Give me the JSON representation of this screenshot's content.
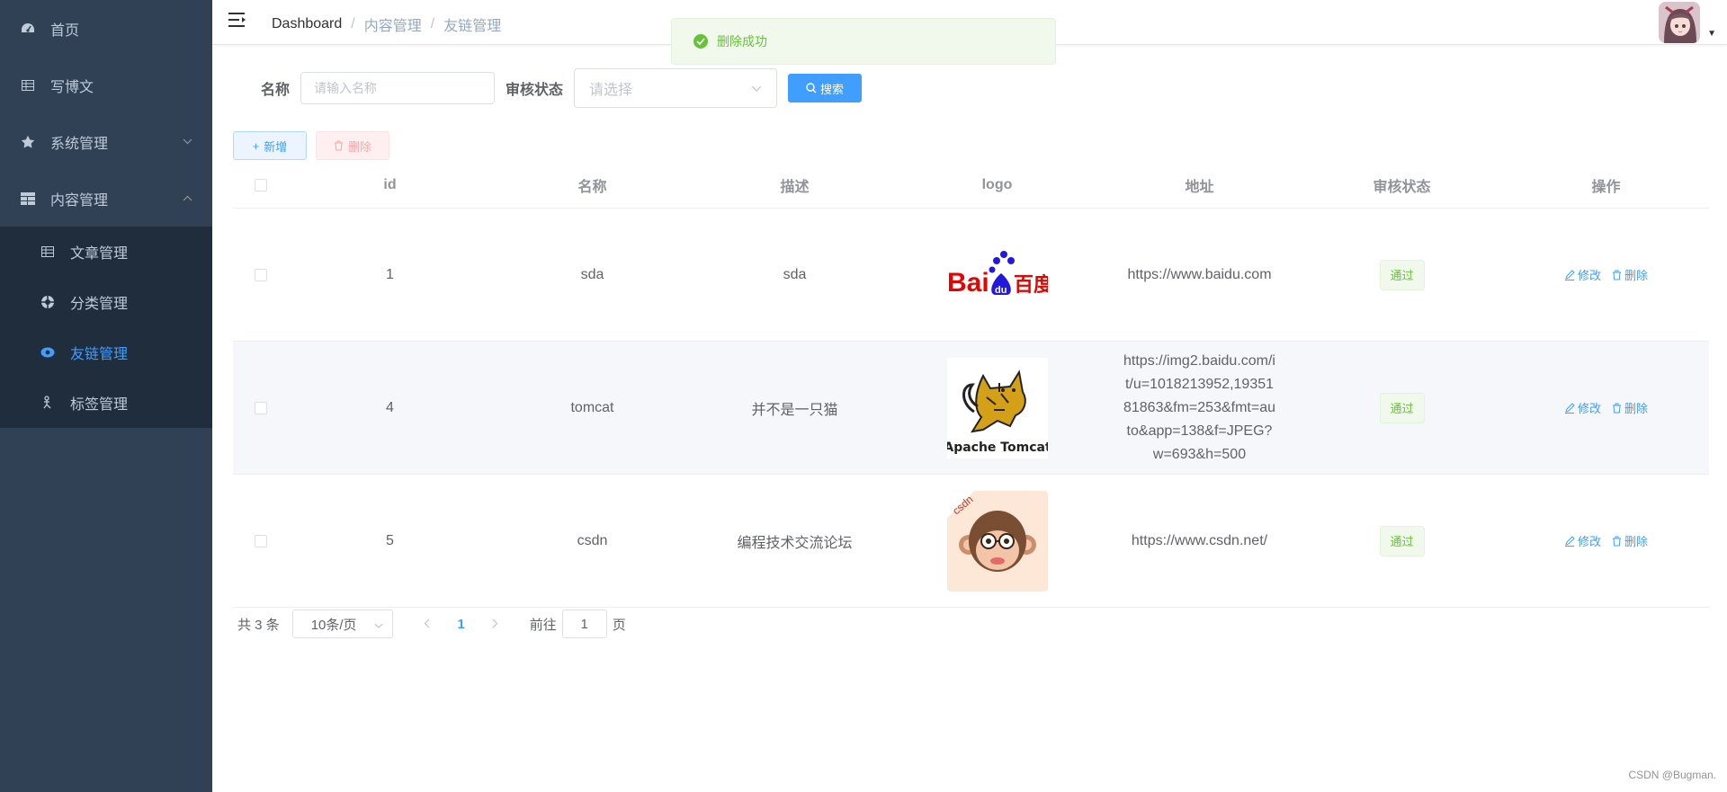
{
  "sidebar": {
    "items": [
      {
        "label": "首页",
        "icon": "dashboard-icon"
      },
      {
        "label": "写博文",
        "icon": "table-icon"
      },
      {
        "label": "系统管理",
        "icon": "star-icon",
        "expanded": false
      },
      {
        "label": "内容管理",
        "icon": "grid-icon",
        "expanded": true
      }
    ],
    "subitems": [
      {
        "label": "文章管理",
        "icon": "table-icon"
      },
      {
        "label": "分类管理",
        "icon": "pinwheel-icon"
      },
      {
        "label": "友链管理",
        "icon": "eye-icon",
        "active": true
      },
      {
        "label": "标签管理",
        "icon": "tag-icon"
      }
    ]
  },
  "header": {
    "breadcrumb": [
      "Dashboard",
      "内容管理",
      "友链管理"
    ],
    "separator": "/"
  },
  "toast": {
    "message": "删除成功",
    "type": "success"
  },
  "search": {
    "name_label": "名称",
    "name_placeholder": "请输入名称",
    "status_label": "审核状态",
    "status_placeholder": "请选择",
    "search_button": "搜索"
  },
  "toolbar": {
    "add_label": "新增",
    "delete_label": "删除"
  },
  "table": {
    "headers": [
      "id",
      "名称",
      "描述",
      "logo",
      "地址",
      "审核状态",
      "操作"
    ],
    "rows": [
      {
        "id": "1",
        "name": "sda",
        "desc": "sda",
        "logo": "baidu-logo",
        "url": "https://www.baidu.com",
        "status": "通过"
      },
      {
        "id": "4",
        "name": "tomcat",
        "desc": "并不是一只猫",
        "logo": "tomcat-logo",
        "logo_text": "Apache Tomcat",
        "url": "https://img2.baidu.com/it/u=1018213952,1935181863&fm=253&fmt=auto&app=138&f=JPEG?w=693&h=500",
        "status": "通过"
      },
      {
        "id": "5",
        "name": "csdn",
        "desc": "编程技术交流论坛",
        "logo": "csdn-logo",
        "url": "https://www.csdn.net/",
        "status": "通过"
      }
    ],
    "edit_label": "修改",
    "delete_label": "删除"
  },
  "pagination": {
    "total_text": "共 3 条",
    "page_size": "10条/页",
    "current_page": "1",
    "goto_label": "前往",
    "goto_value": "1",
    "page_suffix": "页"
  },
  "watermark": "CSDN @Bugman.",
  "colors": {
    "primary": "#409eff",
    "success": "#67c23a",
    "sidebar_bg": "#304156",
    "submenu_bg": "#1f2d3d"
  }
}
